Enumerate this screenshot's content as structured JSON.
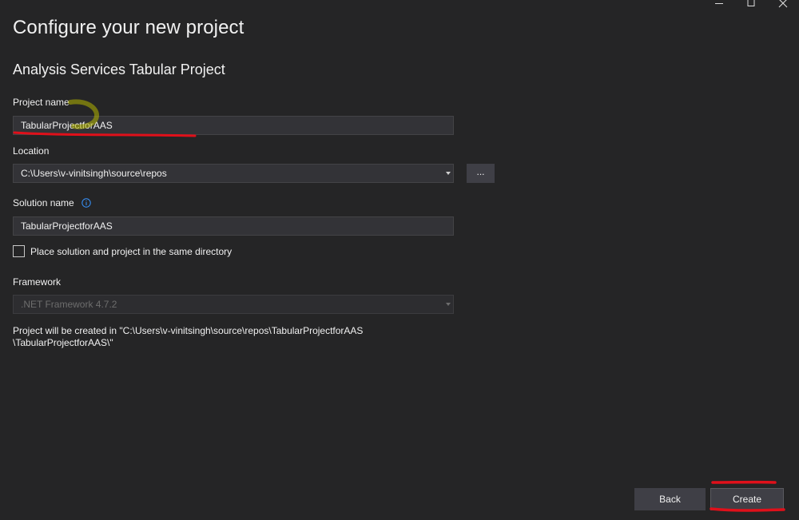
{
  "window": {
    "controls": [
      "minimize",
      "maximize",
      "close"
    ]
  },
  "header": {
    "title": "Configure your new project",
    "project_type": "Analysis Services Tabular Project"
  },
  "form": {
    "project_name": {
      "label": "Project name",
      "value": "TabularProjectforAAS"
    },
    "location": {
      "label": "Location",
      "value": "C:\\Users\\v-vinitsingh\\source\\repos",
      "browse_label": "..."
    },
    "solution_name": {
      "label": "Solution name",
      "value": "TabularProjectforAAS"
    },
    "same_directory": {
      "label": "Place solution and project in the same directory",
      "checked": false
    },
    "framework": {
      "label": "Framework",
      "value": ".NET Framework 4.7.2",
      "disabled": true
    },
    "path_info_line1": "Project will be created in \"C:\\Users\\v-vinitsingh\\source\\repos\\TabularProjectforAAS",
    "path_info_line2": "\\TabularProjectforAAS\\\""
  },
  "footer": {
    "back_label": "Back",
    "create_label": "Create"
  },
  "colors": {
    "background": "#252526",
    "field_background": "#333337",
    "button_background": "#3f3f46",
    "annotation_red": "#e0101a",
    "annotation_highlight": "#b5b600"
  },
  "icons": {
    "solution_info": "info-icon",
    "dropdown": "chevron-down-icon"
  }
}
